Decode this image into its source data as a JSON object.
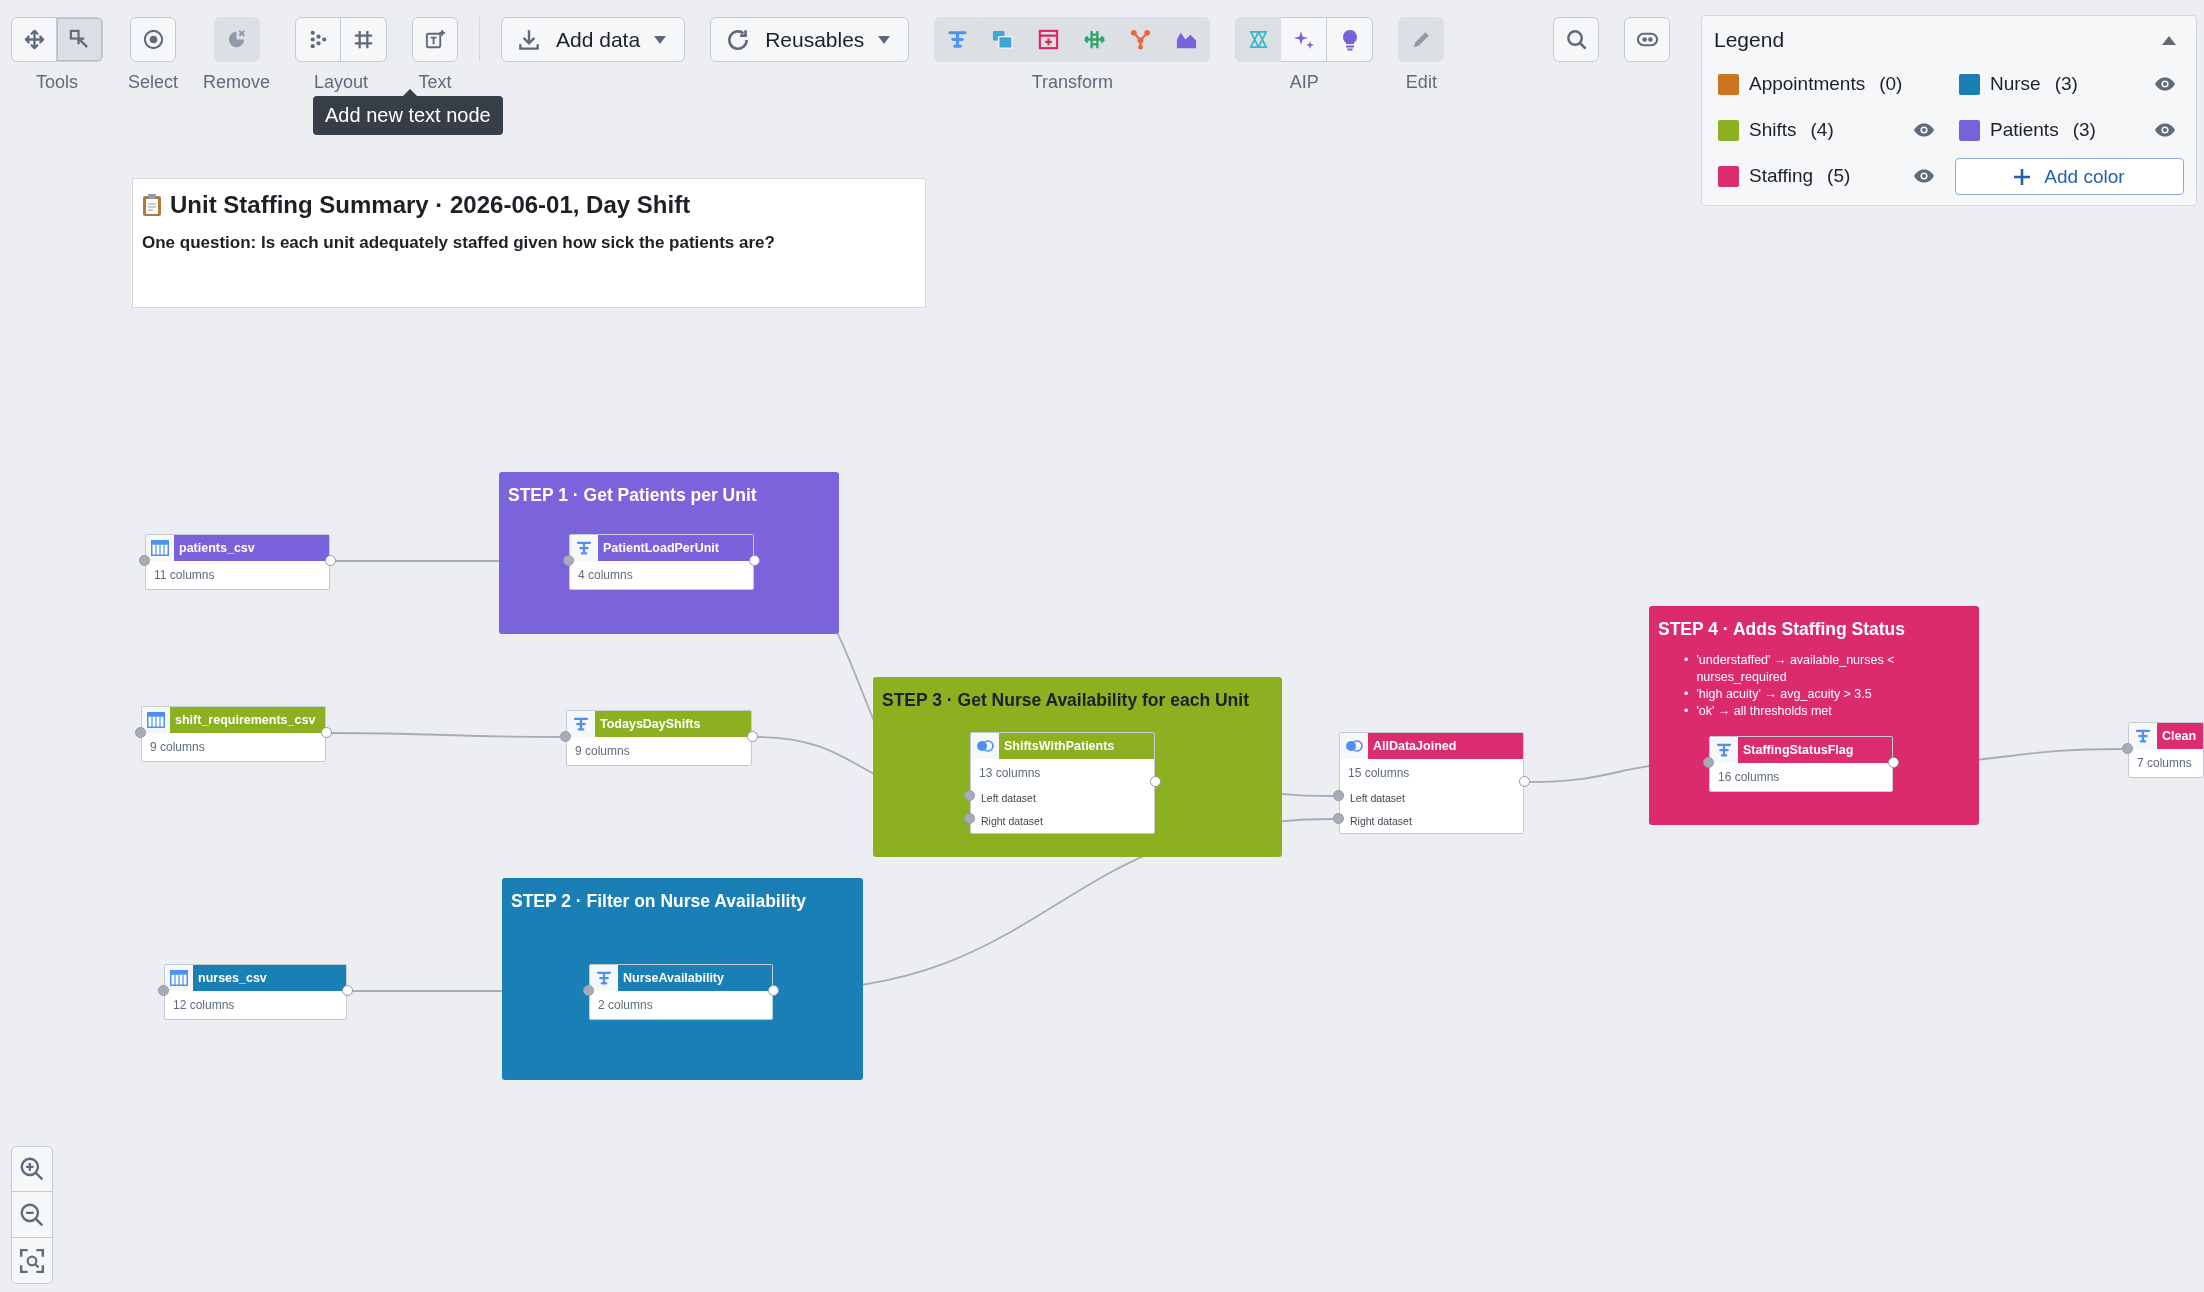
{
  "toolbar": {
    "items": [
      {
        "kind": "group",
        "label": "Tools",
        "buttons": [
          {
            "kind": "move",
            "selected": false
          },
          {
            "kind": "box-select",
            "selected": true
          }
        ]
      },
      {
        "kind": "group",
        "label": "Select",
        "buttons": [
          {
            "kind": "target",
            "disabled": false
          }
        ]
      },
      {
        "kind": "group",
        "label": "Remove",
        "buttons": [
          {
            "kind": "remove",
            "disabled": true
          }
        ]
      },
      {
        "kind": "group",
        "label": "Layout",
        "buttons": [
          {
            "kind": "dots",
            "disabled": false
          },
          {
            "kind": "grid",
            "disabled": false
          }
        ]
      },
      {
        "kind": "group",
        "label": "Text",
        "buttons": [
          {
            "kind": "text-add",
            "disabled": false
          }
        ]
      },
      {
        "kind": "separator"
      },
      {
        "kind": "dropdown",
        "label": "Add data"
      },
      {
        "kind": "dropdown",
        "label": "Reusables"
      },
      {
        "kind": "group",
        "label": "Transform",
        "buttons": [
          {
            "kind": "filter",
            "disabled": true
          },
          {
            "kind": "tables",
            "disabled": true
          },
          {
            "kind": "add-column",
            "disabled": true
          },
          {
            "kind": "arrows",
            "disabled": true
          },
          {
            "kind": "branch",
            "disabled": true
          },
          {
            "kind": "area",
            "disabled": true
          }
        ]
      },
      {
        "kind": "group",
        "label": "AIP",
        "buttons": [
          {
            "kind": "hourglass",
            "disabled": true
          },
          {
            "kind": "sparkle",
            "disabled": false
          },
          {
            "kind": "bulb",
            "disabled": false
          }
        ]
      },
      {
        "kind": "group",
        "label": "Edit",
        "buttons": [
          {
            "kind": "pencil",
            "disabled": true
          }
        ]
      },
      {
        "kind": "spacer"
      },
      {
        "kind": "group",
        "buttons": [
          {
            "kind": "search",
            "disabled": false
          }
        ]
      },
      {
        "kind": "group",
        "buttons": [
          {
            "kind": "toggle",
            "disabled": false
          }
        ]
      }
    ]
  },
  "tooltip": {
    "text": "Add new text node"
  },
  "legend": {
    "title": "Legend",
    "expanded": true,
    "items": [
      {
        "name": "Appointments",
        "count": "(0)",
        "color": "#cc7420",
        "eye": false
      },
      {
        "name": "Nurse",
        "count": "(3)",
        "color": "#1a7fb5",
        "eye": true
      },
      {
        "name": "Shifts",
        "count": "(4)",
        "color": "#8db021",
        "eye": true
      },
      {
        "name": "Patients",
        "count": "(3)",
        "color": "#7961db",
        "eye": true
      },
      {
        "name": "Staffing",
        "count": "(5)",
        "color": "#db2c6f",
        "eye": true
      }
    ],
    "add_button": "Add color"
  },
  "text_node": {
    "title": "Unit Staffing Summary · 2026-06-01, Day Shift",
    "body": "One question: Is each unit adequately staffed given how sick the patients are?"
  },
  "groups": [
    {
      "title": "STEP 1 · Get Patients per Unit",
      "color": "#7b63dc"
    },
    {
      "title": "STEP 3 · Get Nurse Availability for each Unit",
      "color": "#8db021"
    },
    {
      "title": "STEP 2 · Filter on Nurse Availability",
      "color": "#1a7fb5"
    },
    {
      "title": "STEP 4 · Adds Staffing Status",
      "color": "#dc2b6c",
      "bullets": [
        {
          "marker": "•",
          "text": "'understaffed' → available_nurses < nurses_required"
        },
        {
          "marker": "•",
          "text": "'high acuity' → avg_acuity > 3.5"
        },
        {
          "marker": "•",
          "text": "'ok' → all thresholds met"
        }
      ]
    }
  ],
  "nodes": [
    {
      "name": "patients_csv",
      "columns": "11 columns",
      "kind": "dataset",
      "color": "#7961db"
    },
    {
      "name": "PatientLoadPerUnit",
      "columns": "4 columns",
      "kind": "transform",
      "color": "#7961db"
    },
    {
      "name": "shift_requirements_csv",
      "columns": "9 columns",
      "kind": "dataset",
      "color": "#8db021"
    },
    {
      "name": "TodaysDayShifts",
      "columns": "9 columns",
      "kind": "transform",
      "color": "#8db021"
    },
    {
      "name": "ShiftsWithPatients",
      "columns": "13 columns",
      "kind": "join",
      "color": "#8db021",
      "inputs": [
        "Left dataset",
        "Right dataset"
      ]
    },
    {
      "name": "AllDataJoined",
      "columns": "15 columns",
      "kind": "join",
      "color": "#db2c6f",
      "inputs": [
        "Left dataset",
        "Right dataset"
      ]
    },
    {
      "name": "StaffingStatusFlag",
      "columns": "16 columns",
      "kind": "transform",
      "color": "#db2c6f"
    },
    {
      "name": "Clean",
      "columns": "7 columns",
      "kind": "transform",
      "color": "#db2c6f"
    },
    {
      "name": "nurses_csv",
      "columns": "12 columns",
      "kind": "dataset",
      "color": "#1a7fb5"
    },
    {
      "name": "NurseAvailability",
      "columns": "2 columns",
      "kind": "transform",
      "color": "#1a7fb5"
    }
  ]
}
